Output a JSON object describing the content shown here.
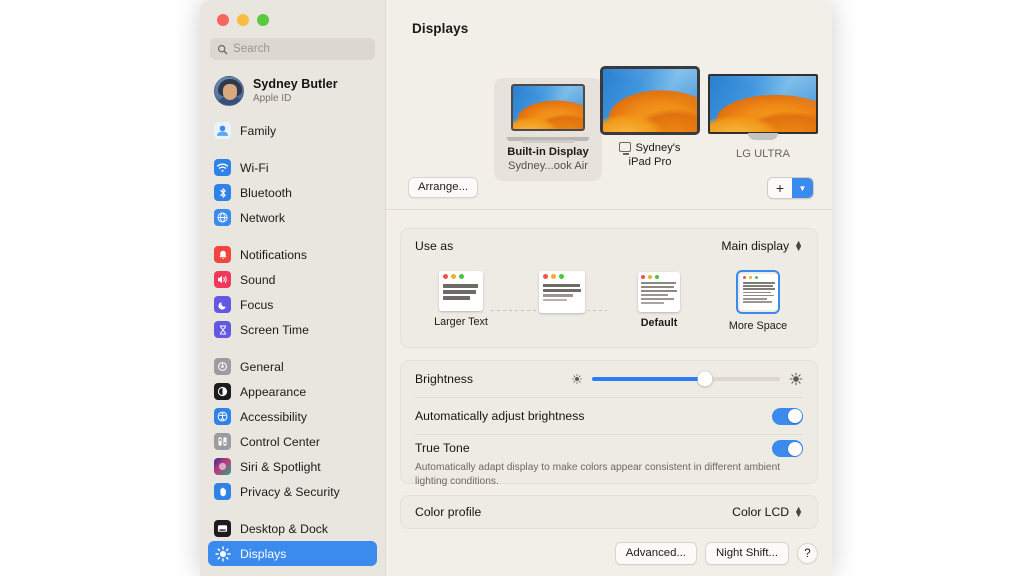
{
  "window": {
    "traffic_lights": [
      "close",
      "minimize",
      "zoom"
    ]
  },
  "sidebar": {
    "search": {
      "placeholder": "Search",
      "value": ""
    },
    "profile": {
      "name": "Sydney Butler",
      "subtitle": "Apple ID"
    },
    "groups": [
      {
        "items": [
          {
            "label": "Family",
            "icon": "family-icon",
            "color": "#4aa3f0"
          }
        ]
      },
      {
        "items": [
          {
            "label": "Wi-Fi",
            "icon": "wifi-icon",
            "color": "#2f82e8"
          },
          {
            "label": "Bluetooth",
            "icon": "bluetooth-icon",
            "color": "#2f82e8"
          },
          {
            "label": "Network",
            "icon": "network-icon",
            "color": "#3b8bee"
          }
        ]
      },
      {
        "items": [
          {
            "label": "Notifications",
            "icon": "notifications-icon",
            "color": "#f1453d"
          },
          {
            "label": "Sound",
            "icon": "sound-icon",
            "color": "#f2385a"
          },
          {
            "label": "Focus",
            "icon": "focus-icon",
            "color": "#6358e4"
          },
          {
            "label": "Screen Time",
            "icon": "screen-time-icon",
            "color": "#6358e4"
          }
        ]
      },
      {
        "items": [
          {
            "label": "General",
            "icon": "general-gear-icon",
            "color": "#8e8e93"
          },
          {
            "label": "Appearance",
            "icon": "appearance-icon",
            "color": "#1c1c1e"
          },
          {
            "label": "Accessibility",
            "icon": "accessibility-icon",
            "color": "#2f82e8"
          },
          {
            "label": "Control Center",
            "icon": "control-center-icon",
            "color": "#9b9ba0"
          },
          {
            "label": "Siri & Spotlight",
            "icon": "siri-icon",
            "color": "#c0397a"
          },
          {
            "label": "Privacy & Security",
            "icon": "privacy-hand-icon",
            "color": "#2f82e8"
          }
        ]
      },
      {
        "items": [
          {
            "label": "Desktop & Dock",
            "icon": "desktop-dock-icon",
            "color": "#1c1c1e"
          },
          {
            "label": "Displays",
            "icon": "displays-icon",
            "color": "#3b8bee",
            "selected": true
          }
        ]
      }
    ],
    "selected_item": "Displays",
    "accent_color": "#3b8bee"
  },
  "main": {
    "title": "Displays",
    "display_picker": {
      "arrange_button": "Arrange...",
      "add_button": "+",
      "add_menu_chevron": "chevron-down",
      "displays": [
        {
          "name": "Built-in Display",
          "subtitle": "Sydney...ook Air",
          "selected": true,
          "kind": "laptop"
        },
        {
          "name": "Sydney's",
          "name2": "iPad Pro",
          "kind": "ipad",
          "has_screen_icon": true
        },
        {
          "name": "LG ULTRA",
          "kind": "monitor"
        }
      ]
    },
    "use_as": {
      "label": "Use as",
      "value": "Main display",
      "resolutions": [
        {
          "label": "Larger Text",
          "selected": false,
          "bold": false
        },
        {
          "label": "",
          "selected": false,
          "bold": false
        },
        {
          "label": "Default",
          "selected": false,
          "bold": true
        },
        {
          "label": "More Space",
          "selected": true,
          "bold": false
        }
      ]
    },
    "brightness": {
      "label": "Brightness",
      "value_percent": 60,
      "low_icon": "brightness-low-icon",
      "high_icon": "brightness-high-icon"
    },
    "auto_brightness": {
      "label": "Automatically adjust brightness",
      "enabled": true
    },
    "true_tone": {
      "label": "True Tone",
      "description": "Automatically adapt display to make colors appear consistent in different ambient lighting conditions.",
      "enabled": true
    },
    "color_profile": {
      "label": "Color profile",
      "value": "Color LCD"
    },
    "footer_buttons": [
      {
        "label": "Advanced..."
      },
      {
        "label": "Night Shift..."
      },
      {
        "label": "?"
      }
    ]
  }
}
